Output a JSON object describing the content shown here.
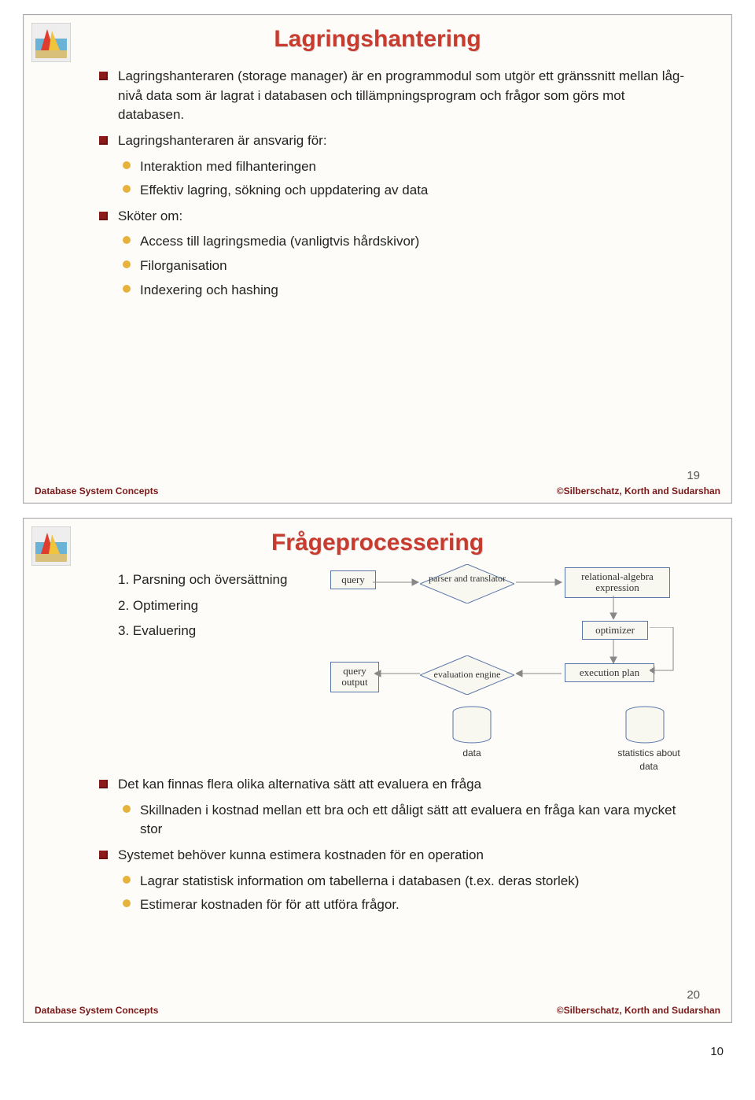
{
  "slide1": {
    "title": "Lagringshantering",
    "b1": "Lagringshanteraren (storage manager) är en programmodul som utgör ett gränssnitt mellan låg-nivå data som är lagrat i databasen och tillämpningsprogram och frågor som görs mot databasen.",
    "b2": "Lagringshanteraren är ansvarig för:",
    "b2s1": "Interaktion med filhanteringen",
    "b2s2": "Effektiv lagring, sökning och uppdatering av data",
    "b3": "Sköter om:",
    "b3s1": "Access till lagringsmedia (vanligtvis hårdskivor)",
    "b3s2": "Filorganisation",
    "b3s3": "Indexering och hashing",
    "pagenum": "19",
    "footer_left": "Database System Concepts",
    "footer_right": "©Silberschatz, Korth and Sudarshan"
  },
  "slide2": {
    "title": "Frågeprocessering",
    "n1": "1.  Parsning och översättning",
    "n2": "2.  Optimering",
    "n3": "3.  Evaluering",
    "flow": {
      "query": "query",
      "parser": "parser and translator",
      "relexp": "relational-algebra expression",
      "optimizer": "optimizer",
      "qout": "query output",
      "evaleng": "evaluation engine",
      "execplan": "execution plan",
      "data": "data",
      "stats": "statistics about data"
    },
    "b1": "Det kan finnas flera olika alternativa sätt att evaluera en fråga",
    "b1s1": "Skillnaden i kostnad mellan ett bra och ett dåligt sätt att evaluera en fråga kan vara mycket stor",
    "b2": "Systemet behöver kunna estimera kostnaden för en operation",
    "b2s1": "Lagrar statistisk information om tabellerna i databasen (t.ex. deras storlek)",
    "b2s2": "Estimerar kostnaden för för att utföra frågor.",
    "pagenum": "20",
    "footer_left": "Database System Concepts",
    "footer_right": "©Silberschatz, Korth and Sudarshan"
  },
  "doc_page": "10"
}
